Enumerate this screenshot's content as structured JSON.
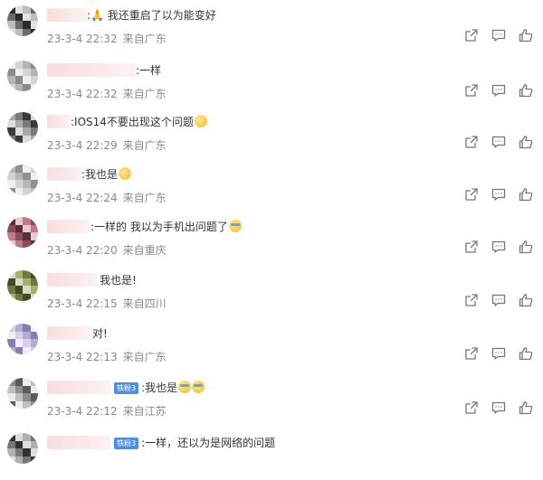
{
  "comments": [
    {
      "text": ":🙏 我还重启了以为能变好",
      "time": "23-3-4 22:32",
      "location": "来自广东",
      "badge": ""
    },
    {
      "text": ":一样",
      "time": "23-3-4 22:32",
      "location": "来自广东",
      "badge": ""
    },
    {
      "text": ":IOS14不要出现这个问题",
      "time": "23-3-4 22:29",
      "location": "来自广东",
      "badge": ""
    },
    {
      "text": ":我也是",
      "time": "23-3-4 22:24",
      "location": "来自广东",
      "badge": ""
    },
    {
      "text": ":一样的 我以为手机出问题了",
      "time": "23-3-4 22:20",
      "location": "来自重庆",
      "badge": ""
    },
    {
      "text": "我也是!",
      "time": "23-3-4 22:15",
      "location": "来自四川",
      "badge": ""
    },
    {
      "text": "对!",
      "time": "23-3-4 22:13",
      "location": "来自广东",
      "badge": ""
    },
    {
      "text": ":我也是",
      "time": "23-3-4 22:12",
      "location": "来自江苏",
      "badge": "铁粉3"
    },
    {
      "text": ":一样，还以为是网络的问题",
      "time": "",
      "location": "",
      "badge": "铁粉3"
    }
  ],
  "icons": {
    "share": "share-icon",
    "reply": "comment-icon",
    "like": "thumbs-up-icon"
  }
}
